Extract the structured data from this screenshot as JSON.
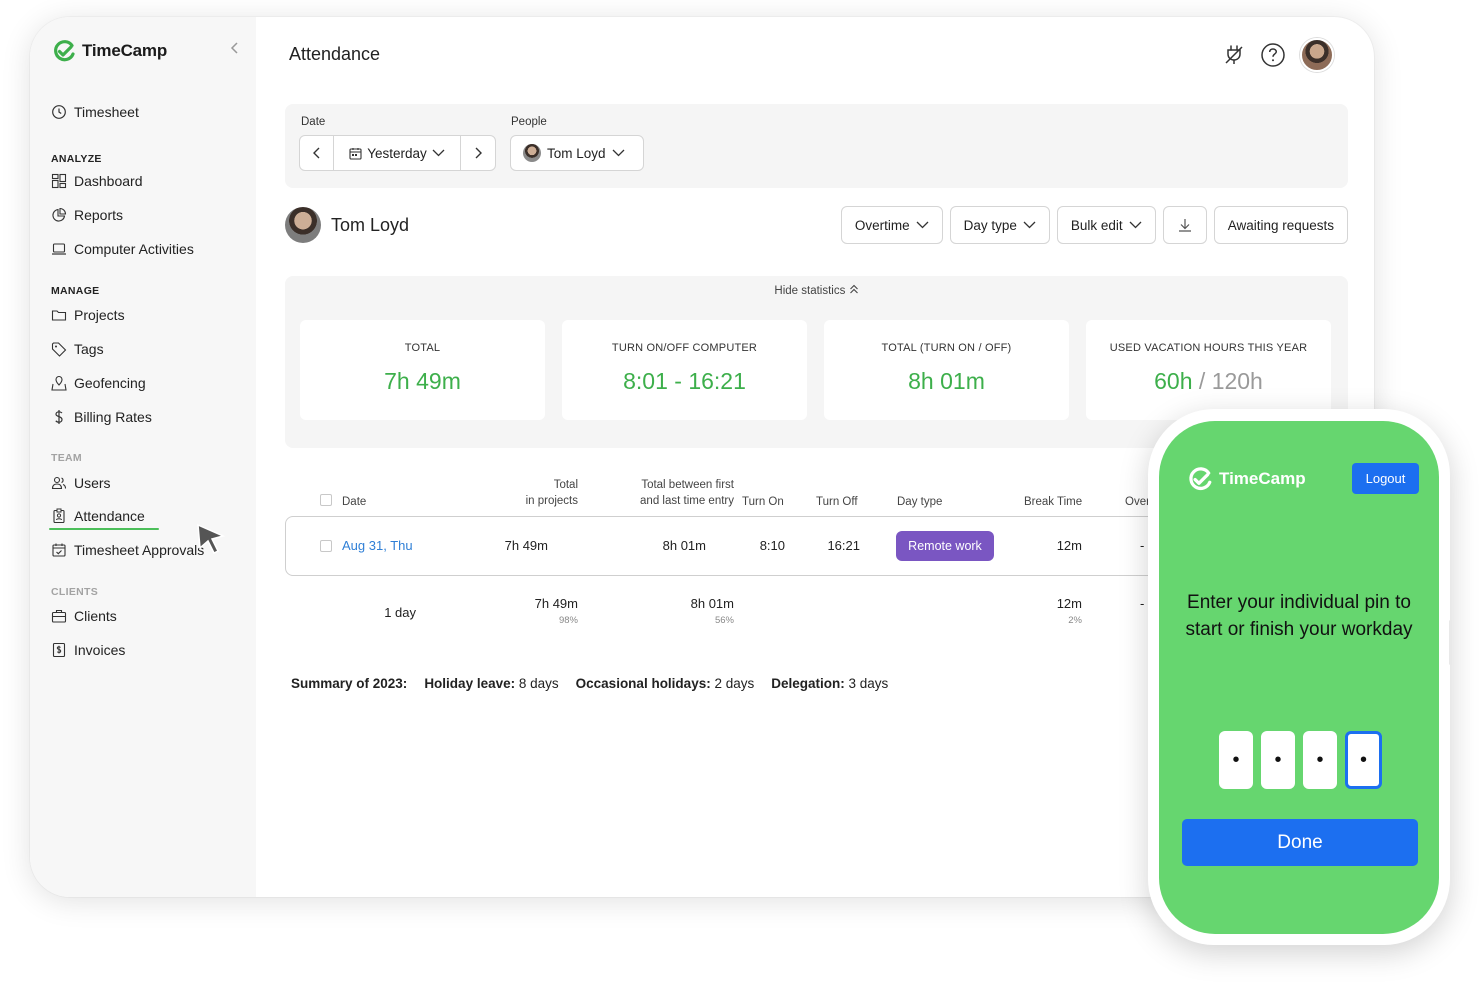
{
  "brand": {
    "name": "TimeCamp"
  },
  "sidebar": {
    "items": [
      {
        "label": "Timesheet"
      },
      {
        "section": "ANALYZE"
      },
      {
        "label": "Dashboard"
      },
      {
        "label": "Reports"
      },
      {
        "label": "Computer Activities"
      },
      {
        "section": "MANAGE"
      },
      {
        "label": "Projects"
      },
      {
        "label": "Tags"
      },
      {
        "label": "Geofencing"
      },
      {
        "label": "Billing Rates"
      },
      {
        "section": "TEAM"
      },
      {
        "label": "Users"
      },
      {
        "label": "Attendance",
        "active": true
      },
      {
        "label": "Timesheet Approvals"
      },
      {
        "section": "CLIENTS"
      },
      {
        "label": "Clients"
      },
      {
        "label": "Invoices"
      }
    ]
  },
  "header": {
    "title": "Attendance"
  },
  "filters": {
    "date_label": "Date",
    "date_value": "Yesterday",
    "people_label": "People",
    "people_value": "Tom Loyd"
  },
  "user": {
    "name": "Tom Loyd"
  },
  "actions": {
    "overtime": "Overtime",
    "day_type": "Day type",
    "bulk_edit": "Bulk edit",
    "awaiting": "Awaiting requests"
  },
  "stats": {
    "toggle_label": "Hide statistics",
    "cards": [
      {
        "label": "TOTAL",
        "value": "7h 49m"
      },
      {
        "label": "TURN ON/OFF COMPUTER",
        "value": "8:01 - 16:21"
      },
      {
        "label": "TOTAL (TURN ON / OFF)",
        "value": "8h 01m"
      },
      {
        "label": "USED VACATION HOURS THIS YEAR",
        "value": "60h",
        "slash": "/",
        "max": "120h"
      }
    ]
  },
  "table": {
    "headers": {
      "date": "Date",
      "total_projects_1": "Total",
      "total_projects_2": "in projects",
      "between_1": "Total between first",
      "between_2": "and last time entry",
      "turn_on": "Turn On",
      "turn_off": "Turn Off",
      "day_type": "Day type",
      "break_time": "Break Time",
      "over": "Over"
    },
    "row": {
      "date": "Aug 31, Thu",
      "total_projects": "7h 49m",
      "between": "8h 01m",
      "turn_on": "8:10",
      "turn_off": "16:21",
      "day_type": "Remote work",
      "break_time": "12m",
      "over": "-"
    },
    "totals": {
      "days": "1 day",
      "total_projects": "7h 49m",
      "total_projects_pct": "98%",
      "between": "8h 01m",
      "between_pct": "56%",
      "break_time": "12m",
      "break_pct": "2%",
      "over": "-"
    }
  },
  "summary": {
    "year_label": "Summary of 2023:",
    "holiday_label": "Holiday leave:",
    "holiday_value": "8 days",
    "occasional_label": "Occasional holidays:",
    "occasional_value": "2 days",
    "delegation_label": "Delegation:",
    "delegation_value": "3 days"
  },
  "phone": {
    "brand": "TimeCamp",
    "logout": "Logout",
    "message": "Enter your individual pin to start or finish your workday",
    "pin": [
      "•",
      "•",
      "•",
      "•"
    ],
    "done": "Done"
  },
  "colors": {
    "accent_green": "#3daf4b",
    "phone_green": "#66d66f",
    "blue": "#1c6ff0",
    "badge_purple": "#7a56c2"
  }
}
